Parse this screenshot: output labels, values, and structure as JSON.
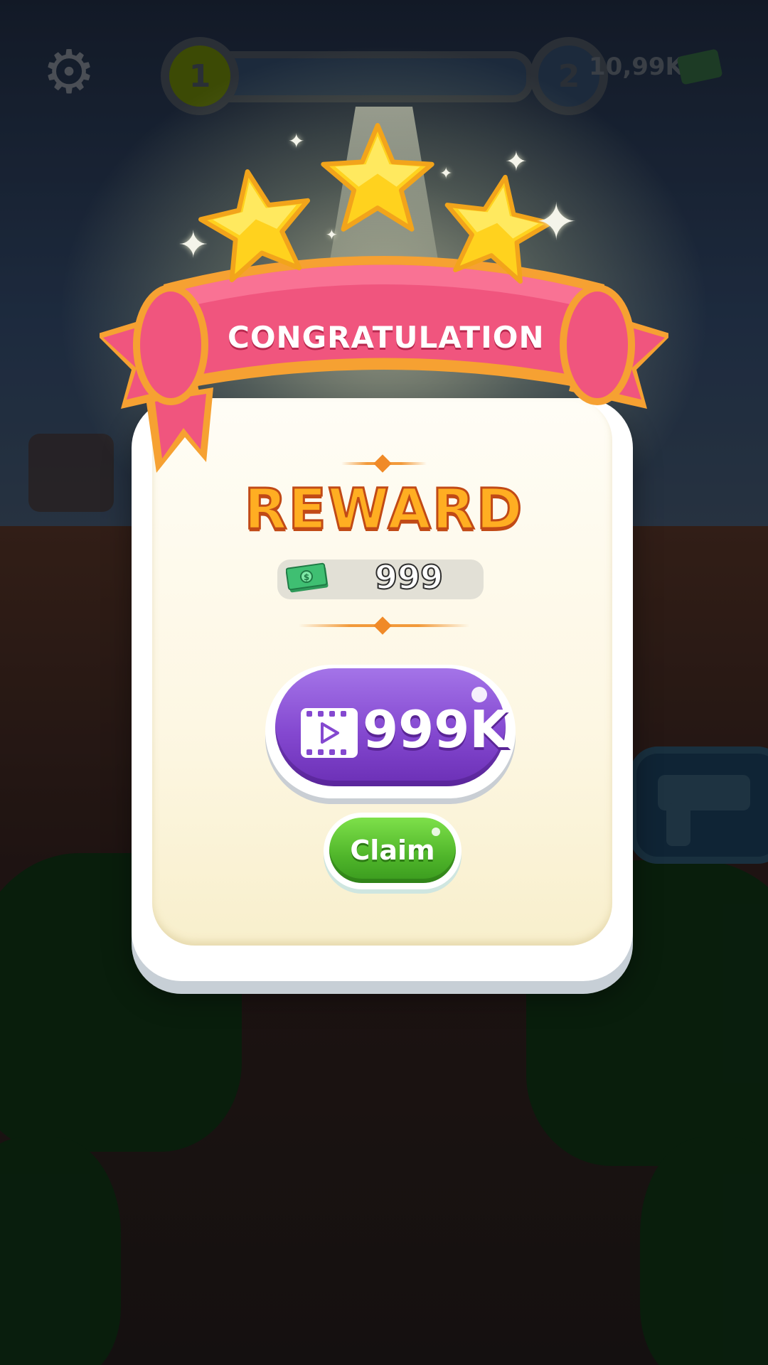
{
  "hud": {
    "level_current": "1",
    "level_next": "2",
    "money": "10,99K"
  },
  "popup": {
    "banner_title": "CONGRATULATION",
    "reward_title": "REWARD",
    "reward_amount": "999",
    "video_button_label": "999K",
    "claim_label": "Claim",
    "stars_earned": 3
  },
  "icons": {
    "settings": "gear-icon",
    "currency": "cash-icon",
    "video": "video-play-icon",
    "weapon": "gun-icon"
  },
  "colors": {
    "banner_pink": "#f0557e",
    "reward_orange": "#ffae22",
    "video_purple": "#8448d0",
    "claim_green": "#4fb52a",
    "star_yellow": "#ffd21e"
  }
}
